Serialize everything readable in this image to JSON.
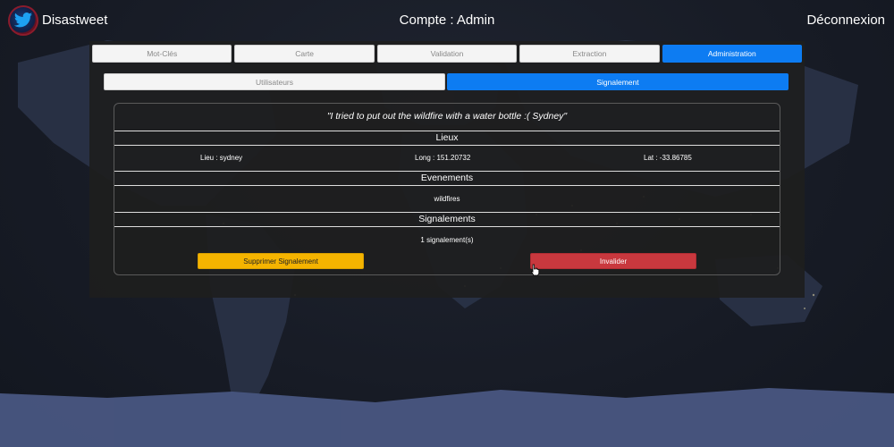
{
  "header": {
    "brand": "Disastweet",
    "account": "Compte : Admin",
    "logout": "Déconnexion"
  },
  "main_tabs": [
    {
      "label": "Mot-Clés",
      "active": false
    },
    {
      "label": "Carte",
      "active": false
    },
    {
      "label": "Validation",
      "active": false
    },
    {
      "label": "Extraction",
      "active": false
    },
    {
      "label": "Administration",
      "active": true
    }
  ],
  "sub_tabs": [
    {
      "label": "Utilisateurs",
      "active": false
    },
    {
      "label": "Signalement",
      "active": true
    }
  ],
  "report": {
    "tweet": "\"I tried to put out the wildfire with a water bottle :( Sydney\"",
    "places_heading": "Lieux",
    "place": "Lieu : sydney",
    "longitude": "Long : 151.20732",
    "latitude": "Lat : -33.86785",
    "events_heading": "Evenements",
    "event": "wildfires",
    "reports_heading": "Signalements",
    "report_count": "1 signalement(s)",
    "delete_button": "Supprimer Signalement",
    "invalidate_button": "Invalider"
  },
  "colors": {
    "accent": "#0d7cf2",
    "warning": "#f5b400",
    "danger": "#c9383e",
    "panel": "#1e1e1e"
  }
}
